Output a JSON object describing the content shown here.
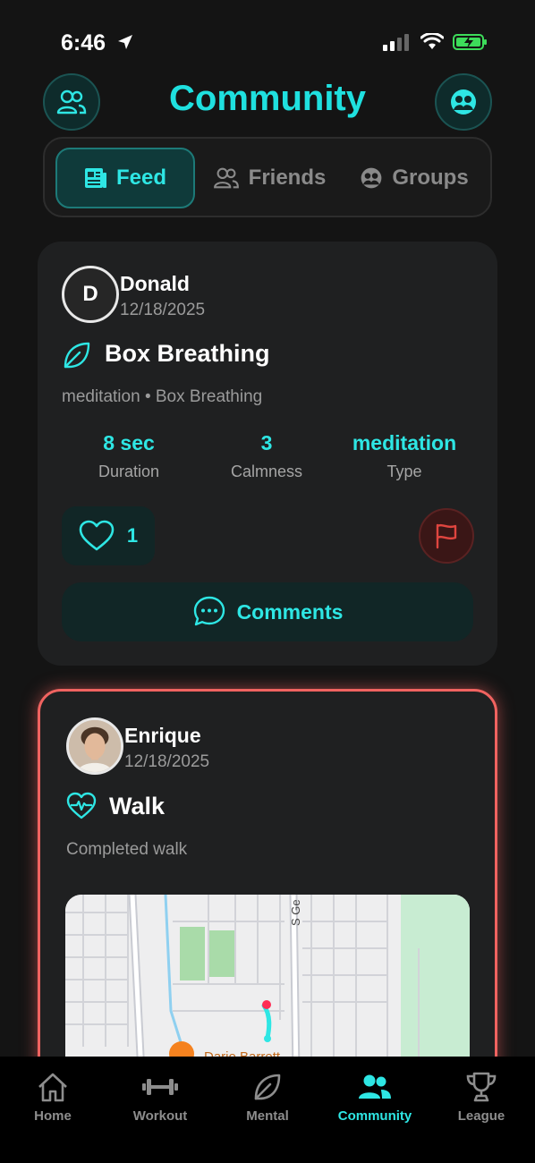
{
  "status": {
    "time": "6:46"
  },
  "header": {
    "title": "Community"
  },
  "tabs": [
    {
      "label": "Feed",
      "active": true
    },
    {
      "label": "Friends",
      "active": false
    },
    {
      "label": "Groups",
      "active": false
    }
  ],
  "posts": [
    {
      "avatar_initial": "D",
      "user": "Donald",
      "date": "12/18/2025",
      "activity_title": "Box Breathing",
      "activity_icon": "leaf-icon",
      "subtitle": "meditation • Box Breathing",
      "stats": [
        {
          "value": "8 sec",
          "label": "Duration"
        },
        {
          "value": "3",
          "label": "Calmness"
        },
        {
          "value": "meditation",
          "label": "Type"
        }
      ],
      "likes": "1",
      "comments_label": "Comments"
    },
    {
      "user": "Enrique",
      "date": "12/18/2025",
      "activity_title": "Walk",
      "activity_icon": "heart-pulse-icon",
      "subtitle": "Completed walk",
      "map": {
        "street_label": "S Ge",
        "place_label": "Dario Barrett"
      }
    }
  ],
  "nav": [
    {
      "label": "Home",
      "icon": "home-icon"
    },
    {
      "label": "Workout",
      "icon": "dumbbell-icon"
    },
    {
      "label": "Mental",
      "icon": "leaf-icon"
    },
    {
      "label": "Community",
      "icon": "people-icon",
      "active": true
    },
    {
      "label": "League",
      "icon": "trophy-icon"
    }
  ],
  "colors": {
    "accent": "#2ee6e4",
    "alert": "#f06360",
    "background": "#141414",
    "card": "#1f2021"
  }
}
